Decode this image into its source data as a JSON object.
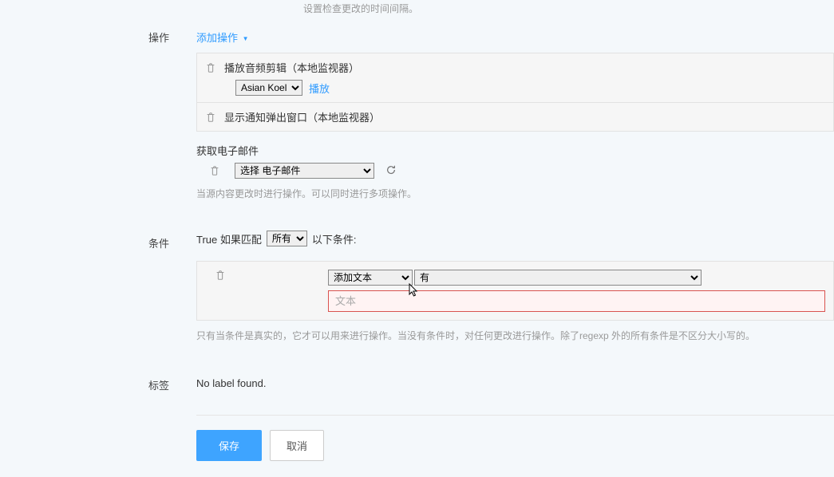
{
  "top_hint": "设置检查更改的时间间隔。",
  "sections": {
    "actions": {
      "label": "操作",
      "add_action": "添加操作",
      "items": [
        {
          "title": "播放音频剪辑（本地监视器）",
          "select_value": "Asian Koel",
          "play_label": "播放"
        },
        {
          "title": "显示通知弹出窗口（本地监视器）"
        }
      ],
      "email": {
        "title": "获取电子邮件",
        "select_value": "选择 电子邮件"
      },
      "help": "当源内容更改时进行操作。可以同时进行多项操作。"
    },
    "conditions": {
      "label": "条件",
      "intro_prefix": "True 如果匹配",
      "match_select": "所有",
      "intro_suffix": "以下条件:",
      "field_select": "添加文本",
      "operator_select": "有",
      "text_placeholder": "文本",
      "help": "只有当条件是真实的，它才可以用来进行操作。当没有条件时，对任何更改进行操作。除了regexp 外的所有条件是不区分大小写的。"
    },
    "labels": {
      "label": "标签",
      "value": "No label found."
    }
  },
  "buttons": {
    "save": "保存",
    "cancel": "取消"
  }
}
